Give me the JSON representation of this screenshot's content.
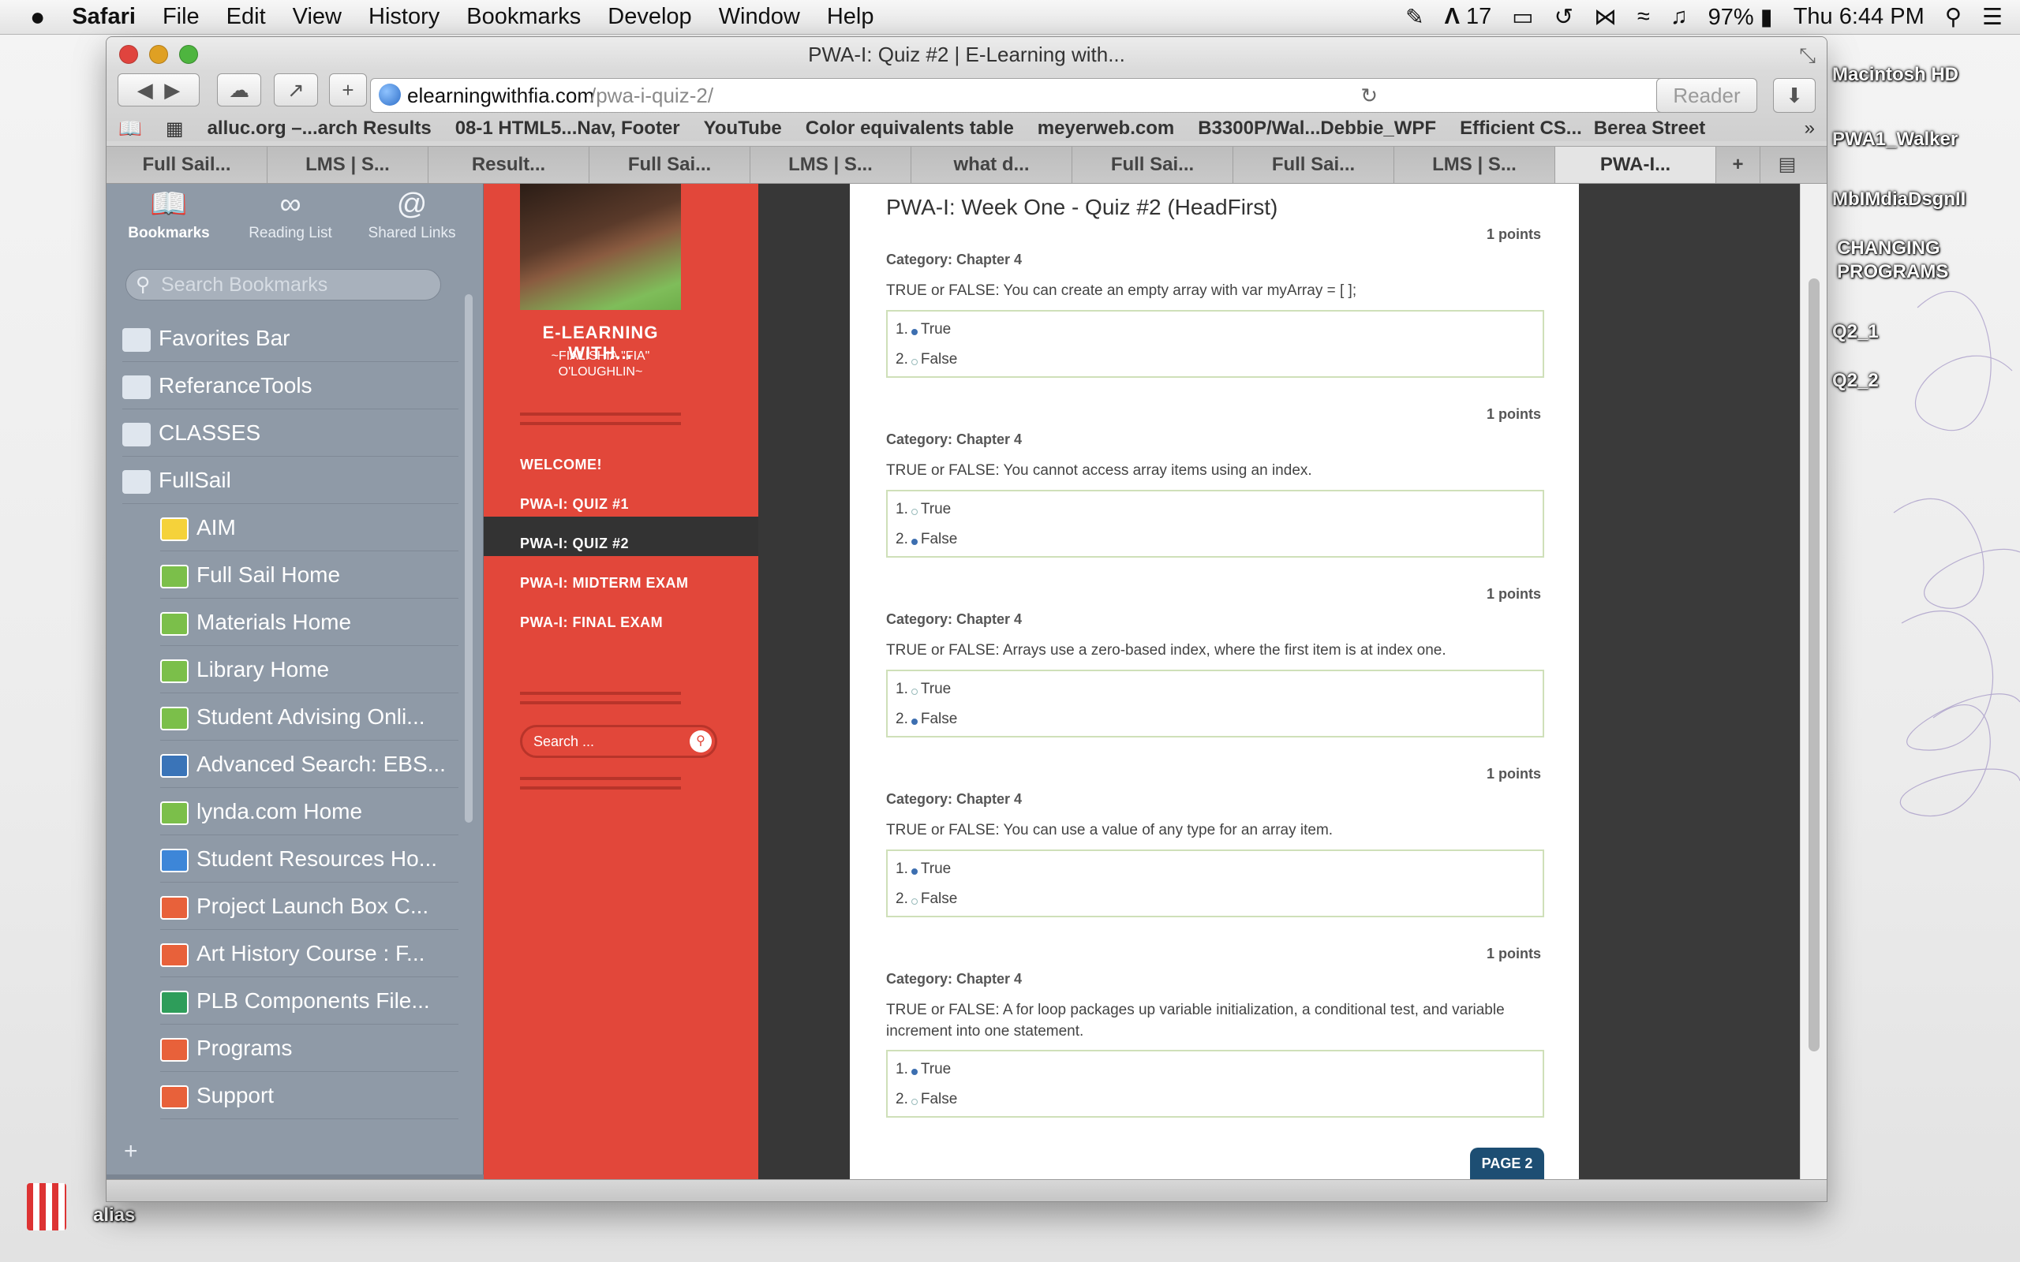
{
  "menubar": {
    "apple": "",
    "items": [
      "Safari",
      "File",
      "Edit",
      "View",
      "History",
      "Bookmarks",
      "Develop",
      "Window",
      "Help"
    ],
    "status": {
      "battery": "97%",
      "clock": "Thu 6:44 PM",
      "badge": "17"
    }
  },
  "desktop": {
    "icons": [
      "Macintosh HD",
      "PWA1_Walker",
      "MbIMdiaDsgnII",
      "CHANGING PROGRAMS",
      "Q2_1",
      "Q2_2",
      "alias"
    ]
  },
  "window": {
    "title": "PWA-I: Quiz #2 | E-Learning with...",
    "url_domain": "elearningwithfia.com",
    "url_path": "/pwa-i-quiz-2/",
    "reader_label": "Reader",
    "bookmarks": [
      "alluc.org –...arch Results",
      "08-1 HTML5...Nav, Footer",
      "YouTube",
      "Color equivalents table",
      "meyerweb.com",
      "B3300P/Wal...Debbie_WPF",
      "Efficient CS...",
      "Berea Street"
    ],
    "tabs": [
      "Full Sail...",
      "LMS | S...",
      "Result...",
      "Full Sai...",
      "LMS | S...",
      "what d...",
      "Full Sai...",
      "Full Sai...",
      "LMS | S...",
      "PWA-I..."
    ]
  },
  "sidebar": {
    "tabs": [
      {
        "label": "Bookmarks",
        "icon": "book-icon"
      },
      {
        "label": "Reading List",
        "icon": "glasses-icon"
      },
      {
        "label": "Shared Links",
        "icon": "at-icon"
      }
    ],
    "search_placeholder": "Search Bookmarks",
    "folders": [
      "Favorites Bar",
      "ReferanceTools",
      "CLASSES",
      "FullSail"
    ],
    "items": [
      {
        "label": "AIM",
        "icon": "aim-icon",
        "color": "#f5d23a"
      },
      {
        "label": "Full Sail Home",
        "icon": "site-icon",
        "color": "#7bbf4a"
      },
      {
        "label": "Materials Home",
        "icon": "site-icon",
        "color": "#7bbf4a"
      },
      {
        "label": "Library Home",
        "icon": "site-icon",
        "color": "#7bbf4a"
      },
      {
        "label": "Student Advising Onli...",
        "icon": "site-icon",
        "color": "#7bbf4a"
      },
      {
        "label": "Advanced Search: EBS...",
        "icon": "ebsco-icon",
        "color": "#3a74b8"
      },
      {
        "label": "lynda.com Home",
        "icon": "site-icon",
        "color": "#7bbf4a"
      },
      {
        "label": "Student Resources Ho...",
        "icon": "globe-icon",
        "color": "#3d86d8"
      },
      {
        "label": "Project Launch Box C...",
        "icon": "app-icon",
        "color": "#e8613a"
      },
      {
        "label": "Art History Course : F...",
        "icon": "app-icon",
        "color": "#e8613a"
      },
      {
        "label": "PLB Components File...",
        "icon": "sheet-icon",
        "color": "#2e9d5a"
      },
      {
        "label": "Programs",
        "icon": "app-icon",
        "color": "#e8613a"
      },
      {
        "label": "Support",
        "icon": "app-icon",
        "color": "#e8613a"
      }
    ],
    "add_label": "+"
  },
  "site": {
    "brand_title": "E-LEARNING WITH...",
    "brand_sub1": "~FIALISHIA \"FIA\"",
    "brand_sub2": "O'LOUGHLIN~",
    "nav": [
      "WELCOME!",
      "PWA-I: QUIZ #1",
      "PWA-I: QUIZ #2",
      "PWA-I: MIDTERM EXAM",
      "PWA-I: FINAL EXAM"
    ],
    "active_nav": 2,
    "search_placeholder": "Search ...",
    "quiz_title": "PWA-I: Week One - Quiz #2 (HeadFirst)",
    "page_button": "PAGE 2",
    "questions": [
      {
        "points": "1 points",
        "category": "Category: Chapter 4",
        "text": "TRUE or FALSE:  You can create an empty array with var myArray = [ ];",
        "options": [
          "True",
          "False"
        ],
        "selected": 0
      },
      {
        "points": "1 points",
        "category": "Category: Chapter 4",
        "text": "TRUE or FALSE:  You cannot access array items using an index.",
        "options": [
          "True",
          "False"
        ],
        "selected": 1
      },
      {
        "points": "1 points",
        "category": "Category: Chapter 4",
        "text": "TRUE or FALSE: Arrays use a zero-based index, where the first item is at index one.",
        "options": [
          "True",
          "False"
        ],
        "selected": 1
      },
      {
        "points": "1 points",
        "category": "Category: Chapter 4",
        "text": "TRUE or FALSE:  You can use a value of any type for an array item.",
        "options": [
          "True",
          "False"
        ],
        "selected": 0
      },
      {
        "points": "1 points",
        "category": "Category: Chapter 4",
        "text": "TRUE or FALSE:  A for loop packages up variable initialization, a conditional test, and variable increment into one statement.",
        "options": [
          "True",
          "False"
        ],
        "selected": 0
      }
    ]
  }
}
